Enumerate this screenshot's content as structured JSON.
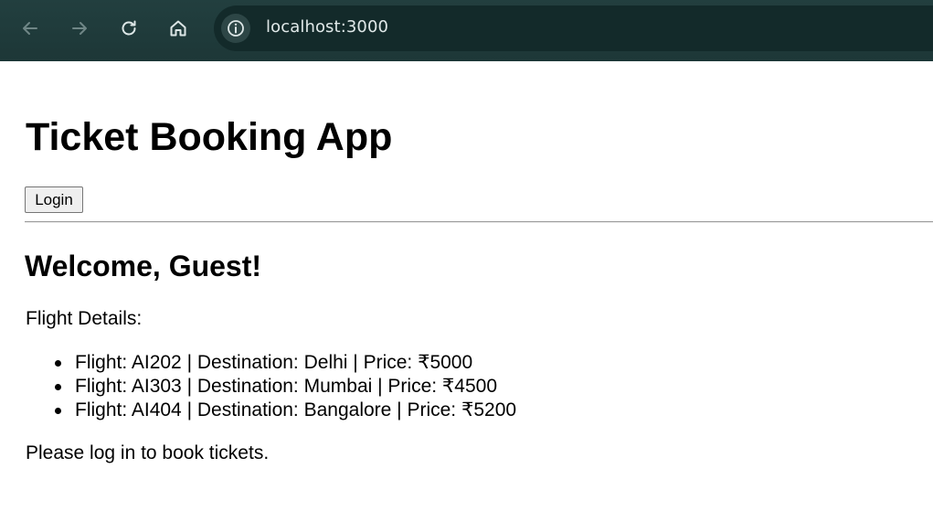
{
  "browser": {
    "url": "localhost:3000",
    "icons": [
      "back-arrow-icon",
      "forward-arrow-icon",
      "reload-icon",
      "home-icon",
      "info-icon"
    ],
    "toolbar_color": "#1f3a3a"
  },
  "app": {
    "title": "Ticket Booking App",
    "login_label": "Login",
    "welcome": "Welcome, Guest!",
    "flight_heading": "Flight Details:",
    "flights": [
      {
        "text": "Flight: AI202 | Destination: Delhi | Price: ₹5000"
      },
      {
        "text": "Flight: AI303 | Destination: Mumbai | Price: ₹4500"
      },
      {
        "text": "Flight: AI404 | Destination: Bangalore | Price: ₹5200"
      }
    ],
    "login_note": "Please log in to book tickets."
  }
}
